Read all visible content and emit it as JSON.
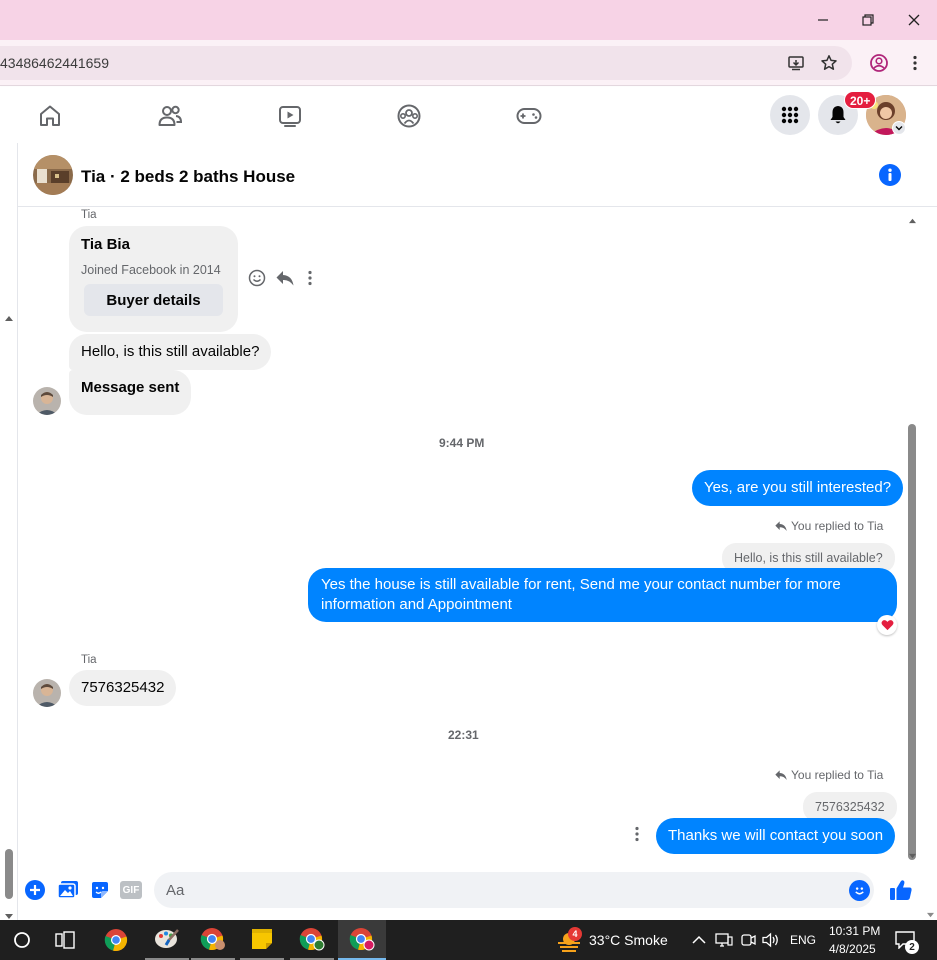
{
  "browser": {
    "url_fragment": "43486462441659"
  },
  "facebook_nav": {
    "notification_count": "20+"
  },
  "chat": {
    "title": "Tia · 2 beds 2 baths House",
    "buyer_card": {
      "sender_name": "Tia",
      "name": "Tia Bia",
      "joined": "Joined Facebook in 2014",
      "button": "Buyer details"
    },
    "messages": {
      "in_1": "Hello, is this still available?",
      "in_2": "Message sent",
      "ts_1": "9:44 PM",
      "out_1": "Yes, are you still interested?",
      "reply_label_1": "You replied to Tia",
      "reply_quote_1": "Hello, is this still available?",
      "out_2": "Yes the house is still available for rent, Send me your contact number for more information and Appointment",
      "sender_2": "Tia",
      "in_3": "7576325432",
      "ts_2": "22:31",
      "reply_label_2": "You replied to Tia",
      "reply_quote_2": "7576325432",
      "out_3": "Thanks we will contact you soon"
    },
    "composer": {
      "placeholder": "Aa",
      "gif_label": "GIF"
    }
  },
  "taskbar": {
    "weather_badge": "4",
    "weather": "33°C  Smoke",
    "lang": "ENG",
    "time": "10:31 PM",
    "date": "4/8/2025",
    "notif_count": "2"
  },
  "colors": {
    "brand_blue": "#0084ff",
    "fb_blue": "#0866ff",
    "titlebar_pink": "#f7d3e6",
    "badge_red": "#e41e3f"
  }
}
